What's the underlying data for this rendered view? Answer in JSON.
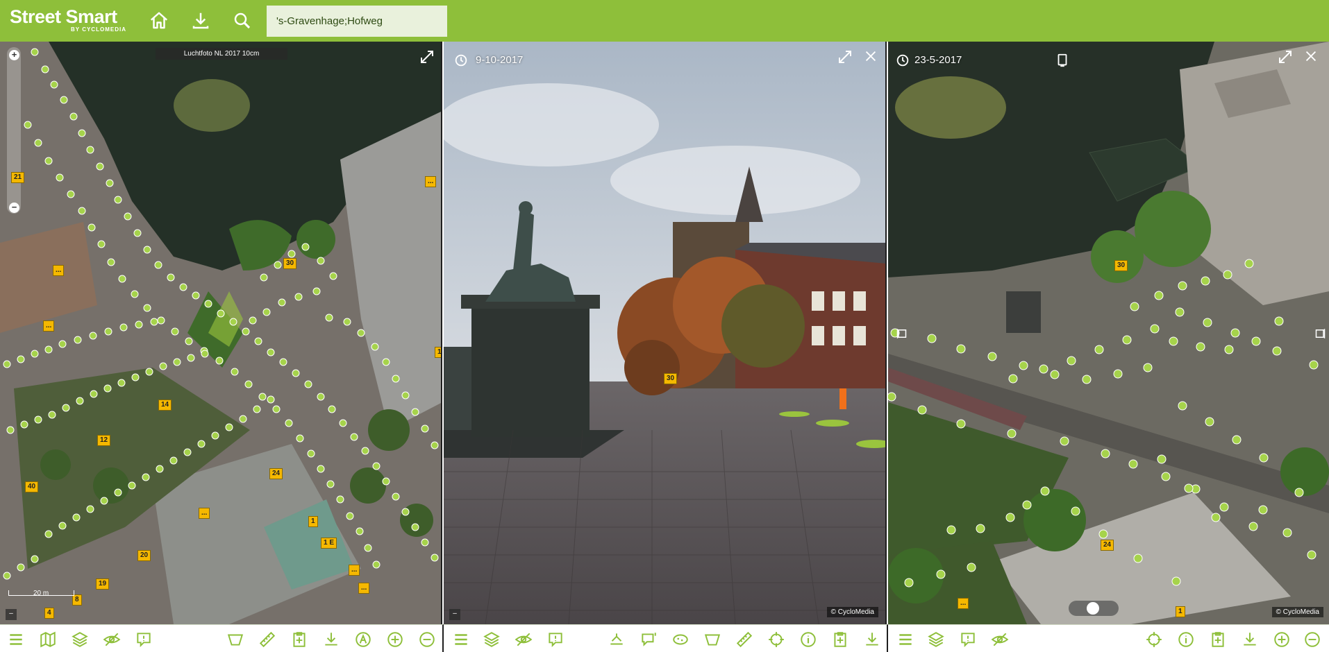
{
  "app": {
    "logo_text": "Street Smart",
    "logo_subtext": "BY CYCLOMEDIA",
    "search_value": "'s-Gravenhage;Hofweg",
    "accent_color": "#8ebf3a",
    "top_icons": [
      "home-icon",
      "download-icon",
      "search-icon"
    ]
  },
  "map_panel": {
    "layer_label": "Luchtfoto NL 2017 10cm",
    "scale_label": "20 m",
    "zoom_in": "+",
    "zoom_out": "−",
    "minimize": "–",
    "badges": [
      "30",
      "14",
      "12",
      "40",
      "24",
      "20",
      "19",
      "1",
      "1 E",
      "4",
      "8",
      "...",
      "...",
      "...",
      "...",
      "...",
      "...",
      "21",
      "1"
    ]
  },
  "pano_panel": {
    "date": "9-10-2017",
    "copyright": "© CycloMedia",
    "badge": "30",
    "minimize": "–"
  },
  "oblique_panel": {
    "date": "23-5-2017",
    "copyright": "© CycloMedia",
    "badges": [
      "30",
      "24",
      "1",
      "..."
    ]
  },
  "toolbars": {
    "map": [
      "menu-icon",
      "map-icon",
      "layers-icon",
      "visibility-off-icon",
      "report-icon",
      "area-measure-icon",
      "ruler-icon",
      "clipboard-add-icon",
      "download-icon",
      "address-icon",
      "zoom-in-icon",
      "zoom-out-icon"
    ],
    "pano": [
      "menu-icon",
      "layers-icon",
      "visibility-off-icon",
      "report-icon",
      "elevation-icon",
      "comment-icon",
      "blur-icon",
      "area-measure-icon",
      "ruler-icon",
      "crosshair-icon",
      "info-icon",
      "clipboard-add-icon",
      "download-icon"
    ],
    "oblique": [
      "menu-icon",
      "layers-icon",
      "report-icon",
      "visibility-off-icon",
      "crosshair-icon",
      "info-icon",
      "clipboard-add-icon",
      "download-icon",
      "zoom-in-icon",
      "zoom-out-icon"
    ]
  }
}
